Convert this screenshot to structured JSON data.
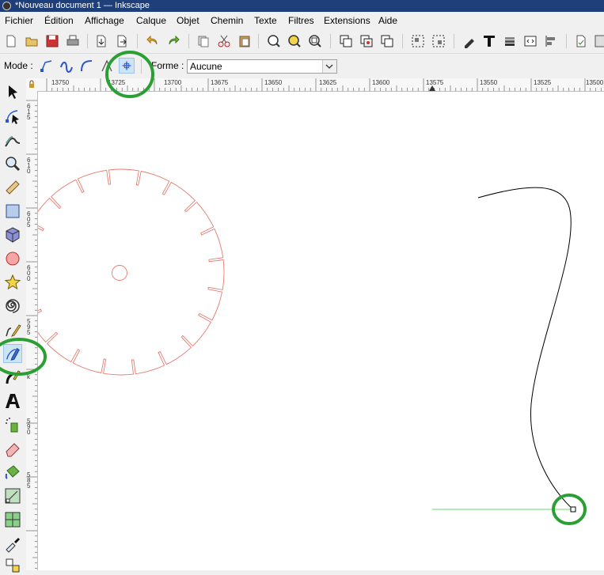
{
  "window": {
    "title": "*Nouveau document 1 — Inkscape"
  },
  "menu": {
    "items": [
      "Fichier",
      "Édition",
      "Affichage",
      "Calque",
      "Objet",
      "Chemin",
      "Texte",
      "Filtres",
      "Extensions",
      "Aide"
    ]
  },
  "controls": {
    "mode_label": "Mode :",
    "shape_label": "Forme :",
    "shape_value": "Aucune"
  },
  "ruler": {
    "horizontal": [
      "13750",
      "13725",
      "13700",
      "13675",
      "13650",
      "13625",
      "13600",
      "13575",
      "13550",
      "13525",
      "13500"
    ],
    "vertical": [
      "6 1 5",
      "6 1 0",
      "6 0 5",
      "6 0 0",
      "5 9 5",
      "k",
      "5 9 0",
      "5 8 5"
    ]
  },
  "colors": {
    "highlight_circle": "#2aa034",
    "gear_stroke": "#e77a6f",
    "curve_stroke": "#000000",
    "guide_line": "#9ee49e",
    "active_bg": "#cde4f7"
  }
}
